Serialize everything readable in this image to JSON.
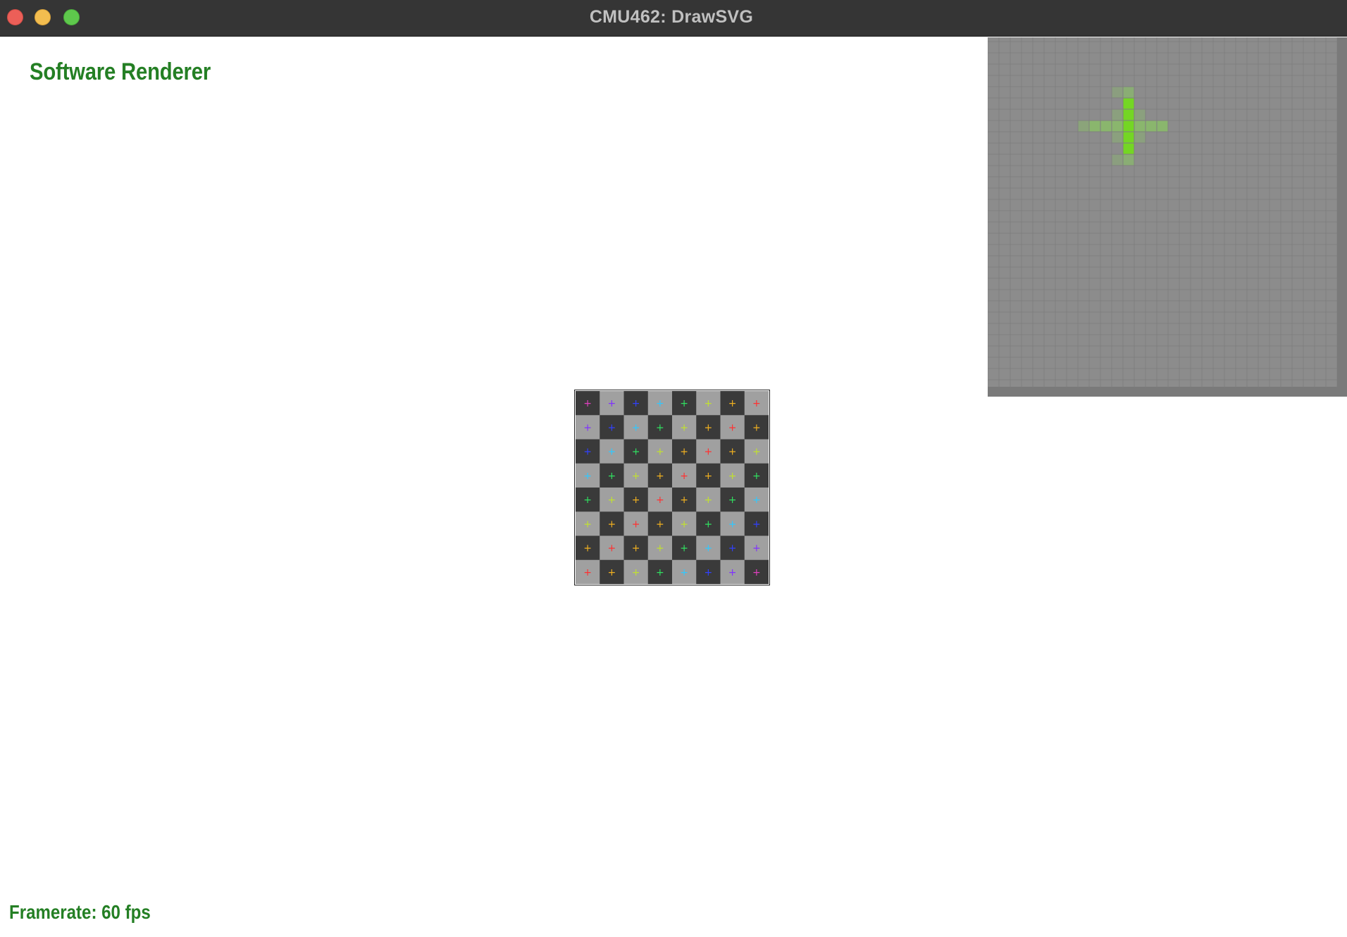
{
  "window": {
    "title": "CMU462: DrawSVG",
    "controls": [
      "close",
      "minimize",
      "zoom"
    ]
  },
  "overlay": {
    "renderer_label": "Software Renderer",
    "framerate_label": "Framerate: 60 fps",
    "text_color": "#247f24"
  },
  "checkerboard": {
    "rows": 8,
    "cols": 8,
    "dark_color": "#3a3a3a",
    "light_color": "#a0a0a0",
    "marker": "+",
    "marker_colors": [
      [
        "#e040c0",
        "#8030ff",
        "#3040ff",
        "#30c8ff",
        "#30e060",
        "#c0e030",
        "#f0b020",
        "#ff3030"
      ],
      [
        "#8030ff",
        "#3040ff",
        "#30c8ff",
        "#30e060",
        "#c0e030",
        "#f0b020",
        "#ff3030",
        "#f0b020"
      ],
      [
        "#3040ff",
        "#30c8ff",
        "#30e060",
        "#c0e030",
        "#f0b020",
        "#ff3030",
        "#f0b020",
        "#c0e030"
      ],
      [
        "#30c8ff",
        "#30e060",
        "#c0e030",
        "#f0b020",
        "#ff3030",
        "#f0b020",
        "#c0e030",
        "#30e060"
      ],
      [
        "#30e060",
        "#c0e030",
        "#f0b020",
        "#ff3030",
        "#f0b020",
        "#c0e030",
        "#30e060",
        "#30c8ff"
      ],
      [
        "#c0e030",
        "#f0b020",
        "#ff3030",
        "#f0b020",
        "#c0e030",
        "#30e060",
        "#30c8ff",
        "#3040ff"
      ],
      [
        "#f0b020",
        "#ff3030",
        "#f0b020",
        "#c0e030",
        "#30e060",
        "#30c8ff",
        "#3040ff",
        "#8030ff"
      ],
      [
        "#ff3030",
        "#f0b020",
        "#c0e030",
        "#30e060",
        "#30c8ff",
        "#3040ff",
        "#8030ff",
        "#e040c0"
      ]
    ]
  },
  "zoom_view": {
    "background_color": "#8c8c8c",
    "grid_color": "#7f7f7f",
    "cross_color": "#74d624",
    "cross_edge_color": "#8ab86c"
  }
}
